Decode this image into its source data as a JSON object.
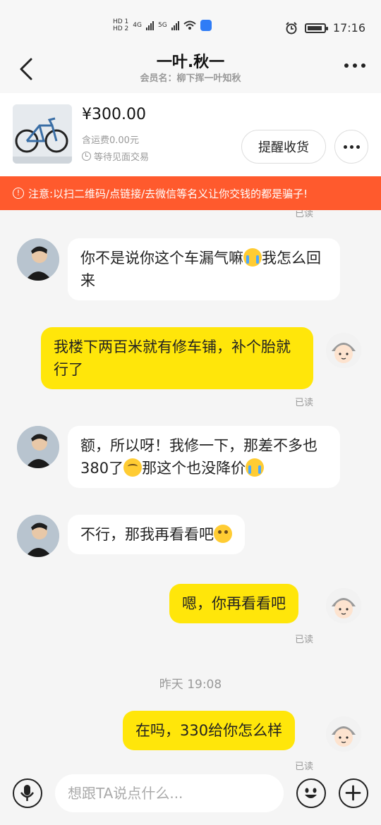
{
  "status_bar": {
    "hd_top": "HD 1",
    "hd_bottom": "HD 2",
    "net1": "4G",
    "net2": "5G",
    "time": "17:16"
  },
  "header": {
    "title": "一叶.秋一",
    "member": "会员名：柳下挥一叶知秋"
  },
  "product": {
    "price": "¥300.00",
    "shipping": "含运费0.00元",
    "status": "等待见面交易",
    "remind_button": "提醒收货"
  },
  "warning": "注意:以扫二维码/点链接/去微信等名义让你交钱的都是骗子!",
  "messages": {
    "read_label": "已读",
    "m1": {
      "a": "你不是说你这个车漏气嘛",
      "b": "我怎么回来"
    },
    "m2": "我楼下两百米就有修车铺，补个胎就行了",
    "m3": {
      "a": "额，所以呀！我修一下，那差不多也380了",
      "b": "那这个也没降价"
    },
    "m4": "不行，那我再看看吧",
    "m5": "嗯，你再看看吧",
    "time_separator": "昨天 19:08",
    "m6": "在吗，330给你怎么样"
  },
  "input": {
    "placeholder": "想跟TA说点什么..."
  },
  "colors": {
    "warning_bg": "#ff5a2d",
    "outgoing_bubble": "#ffe60a",
    "incoming_bubble": "#ffffff"
  }
}
